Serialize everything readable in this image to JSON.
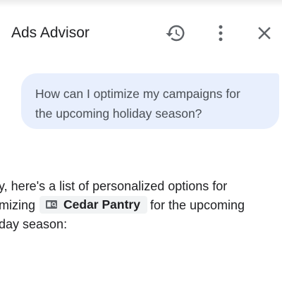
{
  "header": {
    "title": "Ads Advisor",
    "icons": {
      "history": "history-icon",
      "more": "more-vert-icon",
      "close": "close-icon"
    }
  },
  "conversation": {
    "user_message": {
      "line1": "How can I optimize my campaigns for",
      "line2": "the upcoming holiday season?"
    },
    "assistant_reply": {
      "line1": "y, here's a list of personalized options for",
      "line2_prefix": "mizing",
      "account_chip": {
        "icon": "ads-account-icon",
        "label": "Cedar Pantry"
      },
      "line2_suffix": "for the upcoming",
      "line3": "day season:"
    }
  },
  "colors": {
    "bubble_bg": "#e8effd",
    "chip_bg": "#f1f3f4",
    "icon": "#5f6368"
  }
}
